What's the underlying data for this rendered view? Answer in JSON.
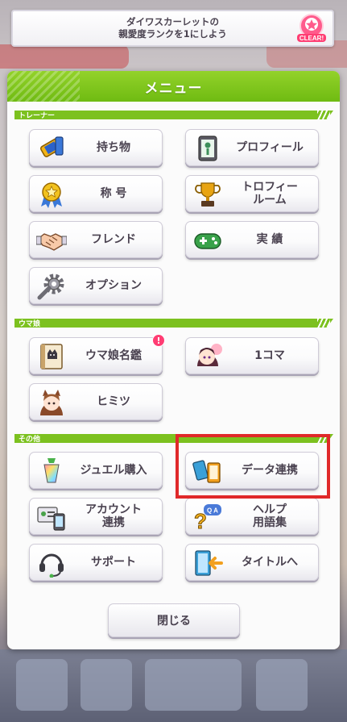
{
  "banner": {
    "line1": "ダイワスカーレットの",
    "line2": "親愛度ランクを1にしよう",
    "badge": "CLEAR!"
  },
  "menu": {
    "title": "メニュー",
    "sections": {
      "trainer": "トレーナー",
      "umamusume": "ウマ娘",
      "other": "その他"
    },
    "buttons": {
      "items": "持ち物",
      "profile": "プロフィール",
      "title_label": "称 号",
      "trophy_line1": "トロフィー",
      "trophy_line2": "ルーム",
      "friends": "フレンド",
      "achievements": "実 績",
      "options": "オプション",
      "encyclopedia": "ウマ娘名鑑",
      "encyclopedia_badge": "!",
      "one_koma": "1コマ",
      "secret": "ヒミツ",
      "jewel": "ジュエル購入",
      "data_link": "データ連携",
      "account_line1": "アカウント",
      "account_line2": "連携",
      "help_line1": "ヘルプ",
      "help_line2": "用語集",
      "support": "サポート",
      "to_title": "タイトルへ"
    },
    "close": "閉じる"
  },
  "colors": {
    "accent_green": "#7cc11f",
    "highlight_red": "#e0292a",
    "text": "#4a4250",
    "notif_pink": "#ff3d73"
  }
}
